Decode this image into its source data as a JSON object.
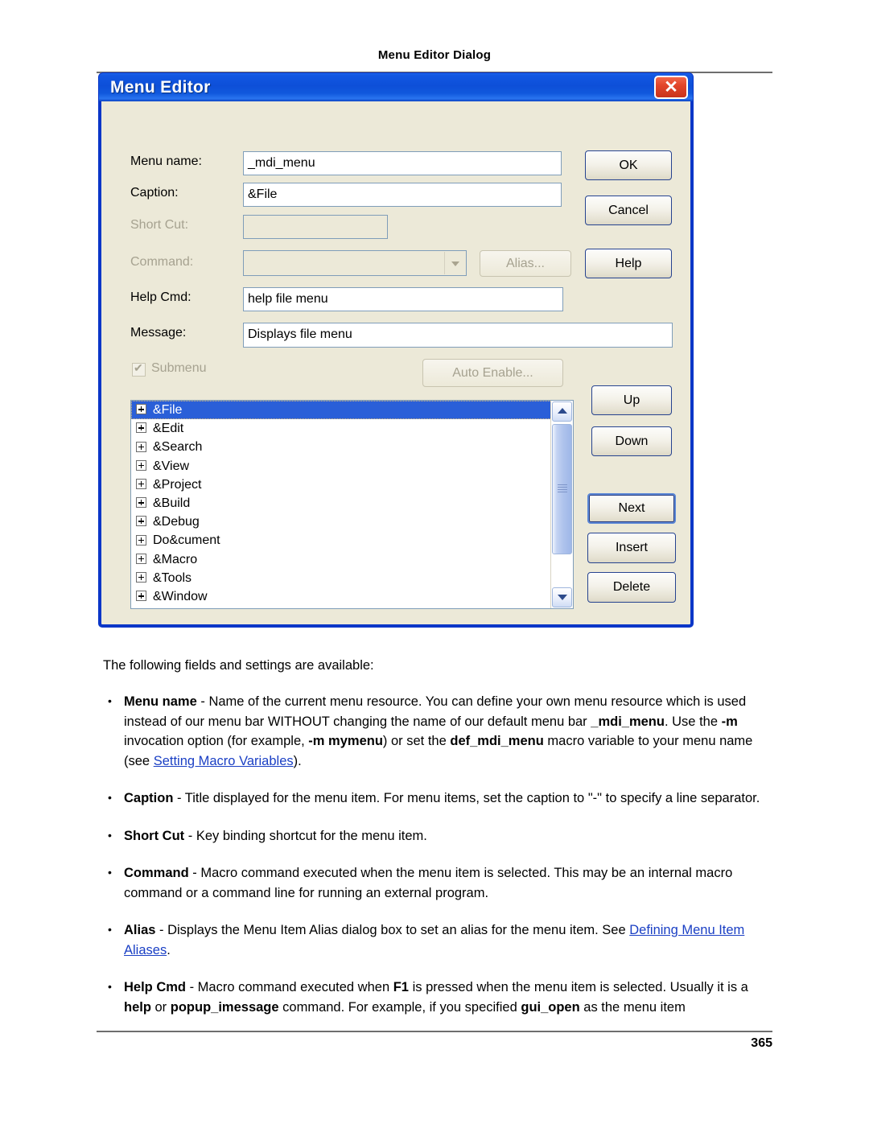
{
  "page": {
    "header_title": "Menu Editor Dialog",
    "page_number": "365"
  },
  "dialog": {
    "title": "Menu Editor",
    "close_icon": "close-icon",
    "fields": {
      "menu_name": {
        "label": "Menu name:",
        "value": "_mdi_menu"
      },
      "caption": {
        "label": "Caption:",
        "value": "&File"
      },
      "short_cut": {
        "label": "Short Cut:",
        "value": ""
      },
      "command": {
        "label": "Command:",
        "value": ""
      },
      "help_cmd": {
        "label": "Help Cmd:",
        "value": "help file menu"
      },
      "message": {
        "label": "Message:",
        "value": "Displays file menu"
      }
    },
    "alias_button": "Alias...",
    "submenu_checkbox": {
      "label": "Submenu",
      "checked": true
    },
    "auto_enable_button": "Auto Enable...",
    "buttons": {
      "ok": "OK",
      "cancel": "Cancel",
      "help": "Help",
      "up": "Up",
      "down": "Down",
      "next": "Next",
      "insert": "Insert",
      "delete": "Delete"
    },
    "tree": {
      "items": [
        {
          "label": "&File",
          "selected": true
        },
        {
          "label": "&Edit",
          "selected": false
        },
        {
          "label": "&Search",
          "selected": false
        },
        {
          "label": "&View",
          "selected": false
        },
        {
          "label": "&Project",
          "selected": false
        },
        {
          "label": "&Build",
          "selected": false
        },
        {
          "label": "&Debug",
          "selected": false
        },
        {
          "label": "Do&cument",
          "selected": false
        },
        {
          "label": "&Macro",
          "selected": false
        },
        {
          "label": "&Tools",
          "selected": false
        },
        {
          "label": "&Window",
          "selected": false
        }
      ],
      "scroll_up_icon": "chevron-up-icon",
      "scroll_down_icon": "chevron-down-icon"
    },
    "colors": {
      "titlebar": "#0d4fd8",
      "dialog_face": "#ece9d8",
      "selection": "#2a5fd8",
      "close_button": "#e2452a"
    }
  },
  "content": {
    "intro": "The following fields and settings are available:",
    "bullets": [
      {
        "term": "Menu name",
        "text_parts": [
          {
            "t": " - Name of the current menu resource. You can define your own menu resource which is used instead of our menu bar WITHOUT changing the name of our default menu bar "
          },
          {
            "t": "_mdi_menu",
            "bold": true
          },
          {
            "t": ". Use the "
          },
          {
            "t": "-m",
            "bold": true
          },
          {
            "t": " invocation option (for example, "
          },
          {
            "t": "-m mymenu",
            "bold": true
          },
          {
            "t": ") or set the "
          },
          {
            "t": "def_mdi_menu",
            "bold": true
          },
          {
            "t": " macro variable to your menu name (see "
          },
          {
            "t": "Setting Macro Variables",
            "link": true
          },
          {
            "t": ")."
          }
        ]
      },
      {
        "term": "Caption",
        "text_parts": [
          {
            "t": " - Title displayed for the menu item. For menu items, set the caption to \"-\" to specify a line separator."
          }
        ]
      },
      {
        "term": "Short Cut",
        "text_parts": [
          {
            "t": " - Key binding shortcut for the menu item."
          }
        ]
      },
      {
        "term": "Command",
        "text_parts": [
          {
            "t": " - Macro command executed when the menu item is selected. This may be an internal macro command or a command line for running an external program."
          }
        ]
      },
      {
        "term": "Alias",
        "text_parts": [
          {
            "t": " - Displays the Menu Item Alias dialog box to set an alias for the menu item. See "
          },
          {
            "t": "Defining Menu Item Aliases",
            "link": true
          },
          {
            "t": "."
          }
        ]
      },
      {
        "term": "Help Cmd",
        "text_parts": [
          {
            "t": " - Macro command executed when "
          },
          {
            "t": "F1",
            "bold": true
          },
          {
            "t": " is pressed when the menu item is selected. Usually it is a "
          },
          {
            "t": "help",
            "bold": true
          },
          {
            "t": " or "
          },
          {
            "t": "popup_imessage",
            "bold": true
          },
          {
            "t": " command. For example, if you specified "
          },
          {
            "t": "gui_open",
            "bold": true
          },
          {
            "t": " as the menu item"
          }
        ]
      }
    ]
  }
}
